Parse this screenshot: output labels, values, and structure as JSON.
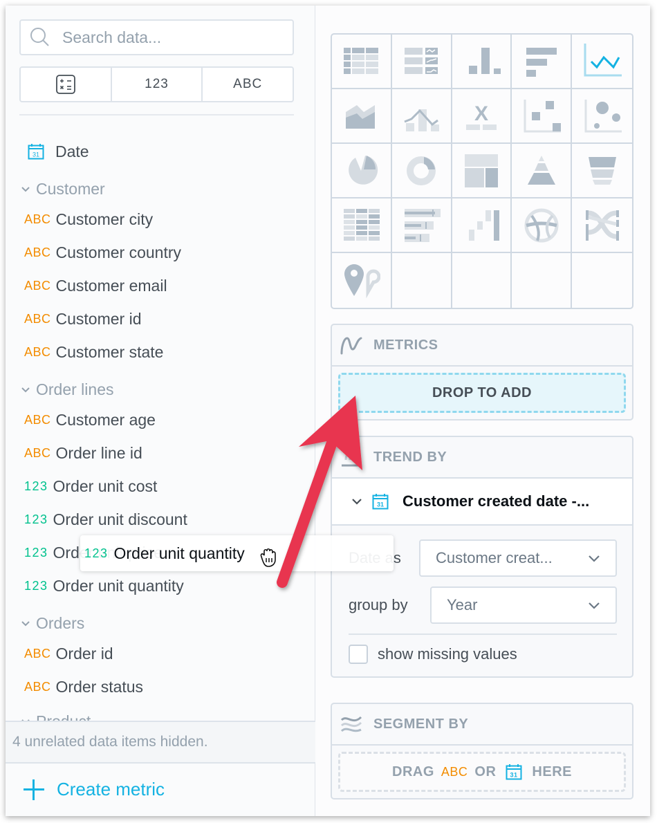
{
  "search": {
    "placeholder": "Search data..."
  },
  "type_filter": [
    {
      "label": "",
      "icon": "calculator-icon"
    },
    {
      "label": "123"
    },
    {
      "label": "ABC"
    }
  ],
  "catalog": {
    "date_item": {
      "label": "Date",
      "icon": "calendar-icon"
    },
    "groups": [
      {
        "title": "Customer",
        "items": [
          {
            "type": "ABC",
            "label": "Customer city"
          },
          {
            "type": "ABC",
            "label": "Customer country"
          },
          {
            "type": "ABC",
            "label": "Customer email"
          },
          {
            "type": "ABC",
            "label": "Customer id"
          },
          {
            "type": "ABC",
            "label": "Customer state"
          }
        ]
      },
      {
        "title": "Order lines",
        "items": [
          {
            "type": "ABC",
            "label": "Customer age"
          },
          {
            "type": "ABC",
            "label": "Order line id"
          },
          {
            "type": "123",
            "label": "Order unit cost"
          },
          {
            "type": "123",
            "label": "Order unit discount"
          },
          {
            "type": "123",
            "label": "Order unit price"
          },
          {
            "type": "123",
            "label": "Order unit quantity"
          }
        ]
      },
      {
        "title": "Orders",
        "items": [
          {
            "type": "ABC",
            "label": "Order id"
          },
          {
            "type": "ABC",
            "label": "Order status"
          }
        ]
      },
      {
        "title": "Product",
        "items": []
      }
    ],
    "hidden_info": "4 unrelated data items hidden.",
    "create_metric": "Create metric"
  },
  "drag_ghost": {
    "type": "123",
    "label": "Order unit quantity"
  },
  "chart_types": [
    {
      "name": "table",
      "selected": false
    },
    {
      "name": "headline-table",
      "selected": false
    },
    {
      "name": "column",
      "selected": false
    },
    {
      "name": "bar",
      "selected": false
    },
    {
      "name": "line",
      "selected": true
    },
    {
      "name": "area",
      "selected": false
    },
    {
      "name": "combo",
      "selected": false
    },
    {
      "name": "headline",
      "selected": false
    },
    {
      "name": "scatter",
      "selected": false
    },
    {
      "name": "bubble",
      "selected": false
    },
    {
      "name": "pie",
      "selected": false
    },
    {
      "name": "donut",
      "selected": false
    },
    {
      "name": "treemap",
      "selected": false
    },
    {
      "name": "pyramid",
      "selected": false
    },
    {
      "name": "funnel",
      "selected": false
    },
    {
      "name": "heatmap",
      "selected": false
    },
    {
      "name": "bullet",
      "selected": false
    },
    {
      "name": "waterfall",
      "selected": false
    },
    {
      "name": "dependency-wheel",
      "selected": false
    },
    {
      "name": "sankey",
      "selected": false
    },
    {
      "name": "geo-pushpin",
      "selected": false
    }
  ],
  "buckets": {
    "metrics": {
      "title": "METRICS",
      "drop_label": "DROP TO ADD"
    },
    "trend_by": {
      "title": "TREND BY",
      "attribute": "Customer created date -...",
      "date_as_label": "Date as",
      "date_as_value": "Customer creat...",
      "group_by_label": "group by",
      "group_by_value": "Year",
      "show_missing_label": "show missing values",
      "show_missing_checked": false
    },
    "segment_by": {
      "title": "SEGMENT BY",
      "drag": "DRAG",
      "abc": "ABC",
      "or": "OR",
      "here": "HERE"
    }
  },
  "colors": {
    "accent": "#14b2e2",
    "attribute": "#f38c00",
    "fact": "#00c18d",
    "annotation_arrow": "#e8354f"
  }
}
